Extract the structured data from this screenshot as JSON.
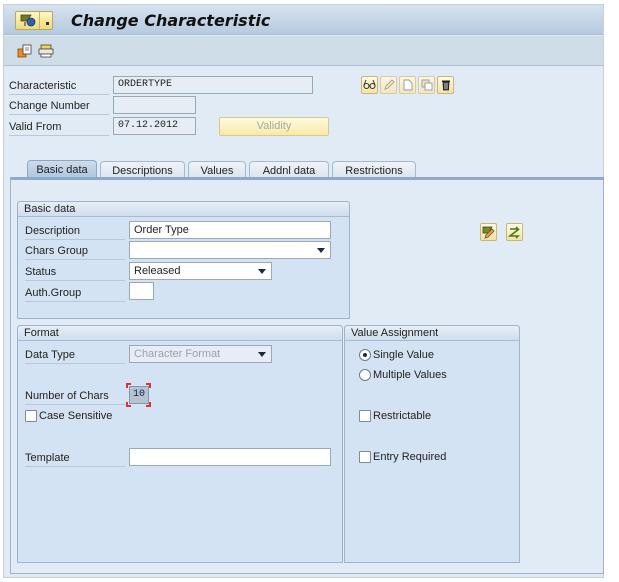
{
  "window": {
    "title": "Change Characteristic",
    "menu_icon": "sap-menu-icon",
    "toolbar_icons": [
      "other-object-icon",
      "print-icon"
    ]
  },
  "header": {
    "fields": [
      {
        "label": "Characteristic",
        "value": "ORDERTYPE"
      },
      {
        "label": "Change Number",
        "value": ""
      },
      {
        "label": "Valid From",
        "value": "07.12.2012"
      }
    ],
    "validity_button": "Validity",
    "action_icons": [
      "display-icon",
      "edit-icon",
      "create-icon",
      "copy-icon",
      "delete-icon"
    ]
  },
  "tabs": [
    {
      "label": "Basic data",
      "active": true
    },
    {
      "label": "Descriptions",
      "active": false
    },
    {
      "label": "Values",
      "active": false
    },
    {
      "label": "Addnl data",
      "active": false
    },
    {
      "label": "Restrictions",
      "active": false
    }
  ],
  "basic_data": {
    "title": "Basic data",
    "description": {
      "label": "Description",
      "value": "Order Type"
    },
    "chars_group": {
      "label": "Chars Group",
      "value": ""
    },
    "status": {
      "label": "Status",
      "value": "Released"
    },
    "auth_group": {
      "label": "Auth.Group",
      "value": ""
    },
    "side_icons": [
      "edit-description-icon",
      "switch-icon"
    ]
  },
  "format": {
    "title": "Format",
    "data_type": {
      "label": "Data Type",
      "value": "Character Format"
    },
    "number_of_chars": {
      "label": "Number of Chars",
      "value": "10"
    },
    "case_sensitive": {
      "label": "Case Sensitive",
      "checked": false
    },
    "template": {
      "label": "Template",
      "value": ""
    }
  },
  "value_assignment": {
    "title": "Value Assignment",
    "single_value": {
      "label": "Single Value",
      "selected": true
    },
    "multiple_values": {
      "label": "Multiple Values",
      "selected": false
    },
    "restrictable": {
      "label": "Restrictable",
      "checked": false
    },
    "entry_required": {
      "label": "Entry Required",
      "checked": false
    }
  },
  "colors": {
    "accent_button": "#f3db7b",
    "panel_bg": "#d4e3f3",
    "window_bg": "#e1ebf5"
  }
}
